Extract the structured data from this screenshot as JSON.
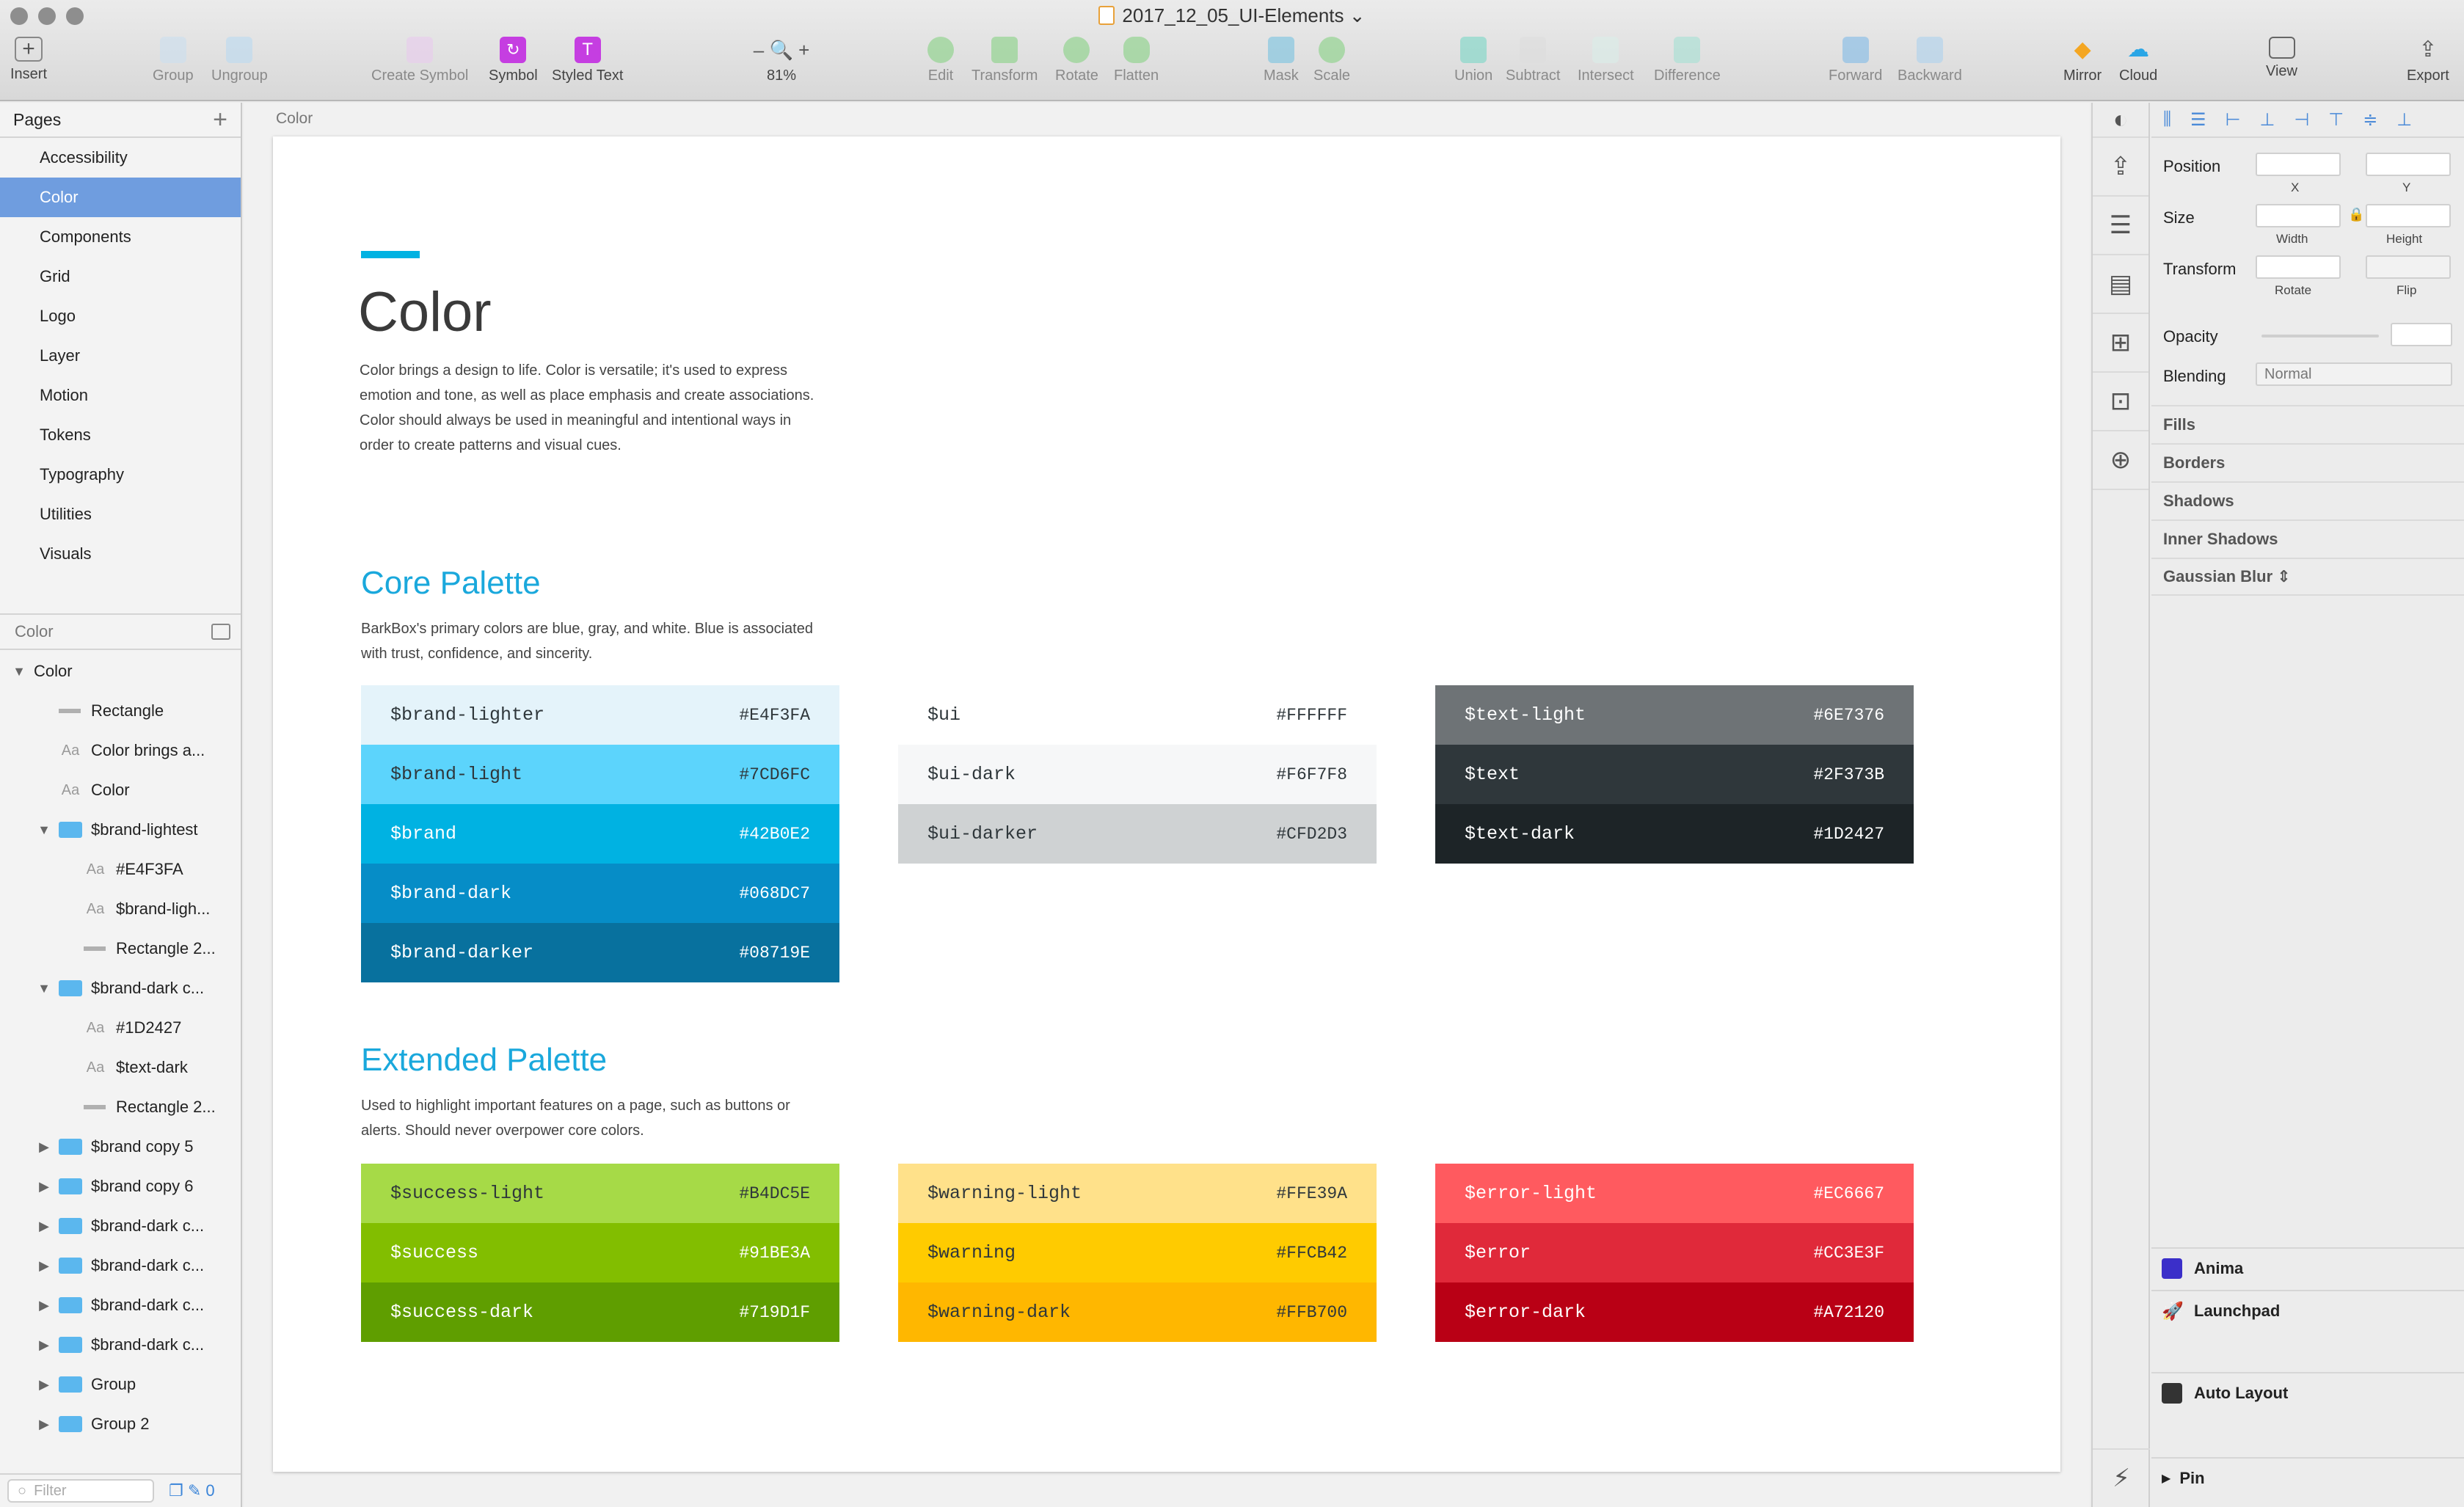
{
  "window": {
    "title": "2017_12_05_UI-Elements"
  },
  "toolbar": {
    "insert": "Insert",
    "group": "Group",
    "ungroup": "Ungroup",
    "create_symbol": "Create Symbol",
    "symbol": "Symbol",
    "styled_text": "Styled Text",
    "zoom_minus": "–",
    "zoom_plus": "+",
    "zoom": "81%",
    "edit": "Edit",
    "transform": "Transform",
    "rotate": "Rotate",
    "flatten": "Flatten",
    "mask": "Mask",
    "scale": "Scale",
    "union": "Union",
    "subtract": "Subtract",
    "intersect": "Intersect",
    "difference": "Difference",
    "forward": "Forward",
    "backward": "Backward",
    "mirror": "Mirror",
    "cloud": "Cloud",
    "view": "View",
    "export": "Export"
  },
  "pages": {
    "header": "Pages",
    "items": [
      "Accessibility",
      "Color",
      "Components",
      "Grid",
      "Logo",
      "Layer",
      "Motion",
      "Tokens",
      "Typography",
      "Utilities",
      "Visuals"
    ],
    "active": "Color"
  },
  "layers": {
    "header": "Color",
    "items": [
      {
        "label": "Color",
        "kind": "page",
        "indent": 0,
        "tri": "▼"
      },
      {
        "label": "Rectangle",
        "kind": "rect",
        "indent": 1,
        "tri": ""
      },
      {
        "label": "Color brings a...",
        "kind": "text",
        "indent": 1,
        "tri": ""
      },
      {
        "label": "Color",
        "kind": "text",
        "indent": 1,
        "tri": ""
      },
      {
        "label": "$brand-lightest",
        "kind": "folder",
        "indent": 1,
        "tri": "▼"
      },
      {
        "label": "#E4F3FA",
        "kind": "text",
        "indent": 2,
        "tri": ""
      },
      {
        "label": "$brand-ligh...",
        "kind": "text",
        "indent": 2,
        "tri": ""
      },
      {
        "label": "Rectangle 2...",
        "kind": "rect",
        "indent": 2,
        "tri": ""
      },
      {
        "label": "$brand-dark c...",
        "kind": "folder",
        "indent": 1,
        "tri": "▼"
      },
      {
        "label": "#1D2427",
        "kind": "text",
        "indent": 2,
        "tri": ""
      },
      {
        "label": "$text-dark",
        "kind": "text",
        "indent": 2,
        "tri": ""
      },
      {
        "label": "Rectangle 2...",
        "kind": "rect",
        "indent": 2,
        "tri": ""
      },
      {
        "label": "$brand copy 5",
        "kind": "folder",
        "indent": 1,
        "tri": "▶"
      },
      {
        "label": "$brand copy 6",
        "kind": "folder",
        "indent": 1,
        "tri": "▶"
      },
      {
        "label": "$brand-dark c...",
        "kind": "folder",
        "indent": 1,
        "tri": "▶"
      },
      {
        "label": "$brand-dark c...",
        "kind": "folder",
        "indent": 1,
        "tri": "▶"
      },
      {
        "label": "$brand-dark c...",
        "kind": "folder",
        "indent": 1,
        "tri": "▶"
      },
      {
        "label": "$brand-dark c...",
        "kind": "folder",
        "indent": 1,
        "tri": "▶"
      },
      {
        "label": "Group",
        "kind": "folder",
        "indent": 1,
        "tri": "▶"
      },
      {
        "label": "Group 2",
        "kind": "folder",
        "indent": 1,
        "tri": "▶"
      }
    ],
    "filter_placeholder": "Filter",
    "filter_count": "0"
  },
  "canvas": {
    "artboard_label": "Color",
    "heading": "Color",
    "intro": "Color brings a design to life. Color is versatile; it's used to express emotion and tone, as well as place emphasis and create associations. Color should always be used in meaningful and intentional ways in order to create patterns and visual cues.",
    "core": {
      "title": "Core Palette",
      "desc": "BarkBox's primary colors are blue, gray, and white. Blue is associated with trust, confidence, and sincerity.",
      "groups": [
        [
          {
            "name": "$brand-lighter",
            "hex": "#E4F3FA",
            "bg": "#E4F3FA",
            "fg": "#2f373b"
          },
          {
            "name": "$brand-light",
            "hex": "#7CD6FC",
            "bg": "#5CD4FC",
            "fg": "#2f373b"
          },
          {
            "name": "$brand",
            "hex": "#42B0E2",
            "bg": "#00B2E2",
            "fg": "#ffffff"
          },
          {
            "name": "$brand-dark",
            "hex": "#068DC7",
            "bg": "#068DC7",
            "fg": "#ffffff"
          },
          {
            "name": "$brand-darker",
            "hex": "#08719E",
            "bg": "#08719E",
            "fg": "#ffffff"
          }
        ],
        [
          {
            "name": "$ui",
            "hex": "#FFFFFF",
            "bg": "#FFFFFF",
            "fg": "#2f373b"
          },
          {
            "name": "$ui-dark",
            "hex": "#F6F7F8",
            "bg": "#F6F7F8",
            "fg": "#2f373b"
          },
          {
            "name": "$ui-darker",
            "hex": "#CFD2D3",
            "bg": "#CFD2D3",
            "fg": "#2f373b"
          }
        ],
        [
          {
            "name": "$text-light",
            "hex": "#6E7376",
            "bg": "#6E7376",
            "fg": "#ffffff"
          },
          {
            "name": "$text",
            "hex": "#2F373B",
            "bg": "#2F373B",
            "fg": "#ffffff"
          },
          {
            "name": "$text-dark",
            "hex": "#1D2427",
            "bg": "#1D2427",
            "fg": "#ffffff"
          }
        ]
      ]
    },
    "extended": {
      "title": "Extended Palette",
      "desc": "Used to highlight important features on a page, such as buttons or alerts. Should never overpower core colors.",
      "groups": [
        [
          {
            "name": "$success-light",
            "hex": "#B4DC5E",
            "bg": "#A6DA47",
            "fg": "#2f373b"
          },
          {
            "name": "$success",
            "hex": "#91BE3A",
            "bg": "#82BE00",
            "fg": "#ffffff"
          },
          {
            "name": "$success-dark",
            "hex": "#719D1F",
            "bg": "#5F9E00",
            "fg": "#ffffff"
          }
        ],
        [
          {
            "name": "$warning-light",
            "hex": "#FFE39A",
            "bg": "#FFE18A",
            "fg": "#2f373b"
          },
          {
            "name": "$warning",
            "hex": "#FFCB42",
            "bg": "#FFCB00",
            "fg": "#2f373b"
          },
          {
            "name": "$warning-dark",
            "hex": "#FFB700",
            "bg": "#FFB700",
            "fg": "#2f373b"
          }
        ],
        [
          {
            "name": "$error-light",
            "hex": "#EC6667",
            "bg": "#FF5A5F",
            "fg": "#ffffff"
          },
          {
            "name": "$error",
            "hex": "#CC3E3F",
            "bg": "#E0293A",
            "fg": "#ffffff"
          },
          {
            "name": "$error-dark",
            "hex": "#A72120",
            "bg": "#B90015",
            "fg": "#ffffff"
          }
        ]
      ]
    }
  },
  "inspector": {
    "position": "Position",
    "x": "X",
    "y": "Y",
    "size": "Size",
    "width": "Width",
    "height": "Height",
    "transform": "Transform",
    "rotate": "Rotate",
    "flip": "Flip",
    "opacity": "Opacity",
    "blending": "Blending",
    "blending_value": "Normal",
    "fills": "Fills",
    "borders": "Borders",
    "shadows": "Shadows",
    "inner_shadows": "Inner Shadows",
    "gaussian_blur": "Gaussian Blur",
    "anima": "Anima",
    "launchpad": "Launchpad",
    "auto_layout": "Auto Layout",
    "pin": "Pin"
  }
}
